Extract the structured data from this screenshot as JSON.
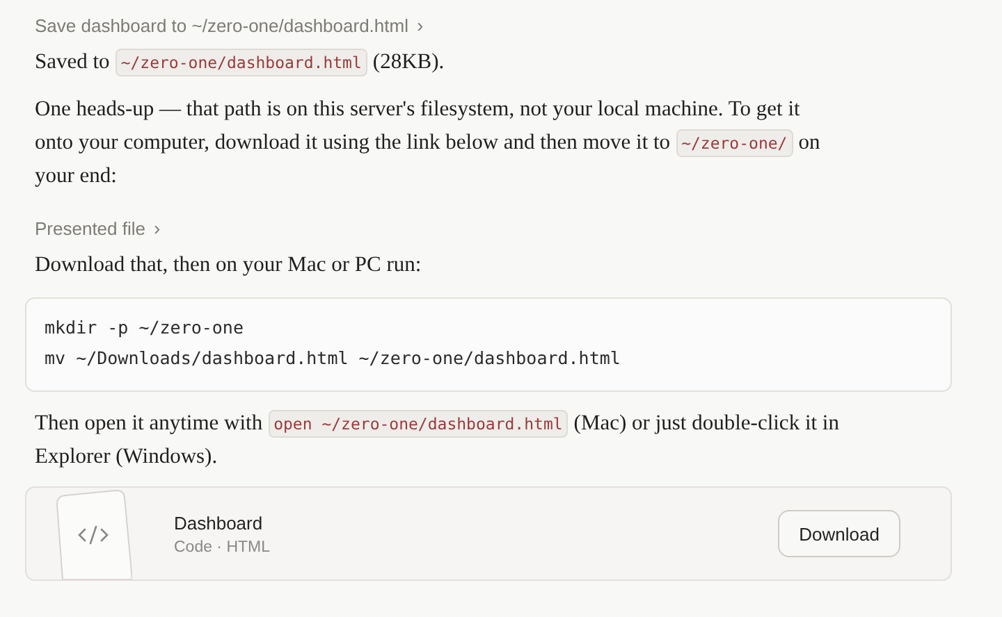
{
  "tool_step": {
    "label": "Save dashboard to ~/zero-one/dashboard.html",
    "chevron": "›"
  },
  "blocks": [
    {
      "kind": "paragraph",
      "lines": [
        [
          {
            "kind": "text",
            "text": "Saved to"
          },
          {
            "kind": "code",
            "text": "~/zero-one/dashboard.html"
          },
          {
            "kind": "text",
            "text": "(28KB)."
          }
        ]
      ]
    },
    {
      "kind": "paragraph",
      "lines": [
        [
          {
            "kind": "text",
            "text": "One heads-up — that path is on this server's filesystem, not your local machine. To get it"
          }
        ],
        [
          {
            "kind": "text",
            "text": "onto your computer, download it using the link below and then move it to"
          },
          {
            "kind": "code",
            "text": "~/zero-one/"
          },
          {
            "kind": "text",
            "text": "on"
          }
        ],
        [
          {
            "kind": "text",
            "text": "your end:"
          }
        ]
      ]
    },
    {
      "kind": "step",
      "label": "Presented file",
      "chevron": "›"
    },
    {
      "kind": "paragraph",
      "lines": [
        [
          {
            "kind": "text",
            "text": "Download that, then on your Mac or PC run:"
          }
        ]
      ]
    },
    {
      "kind": "codeblock",
      "lines": [
        "mkdir -p ~/zero-one",
        "mv ~/Downloads/dashboard.html ~/zero-one/dashboard.html"
      ]
    },
    {
      "kind": "paragraph",
      "lines": [
        [
          {
            "kind": "text",
            "text": "Then open it anytime with"
          },
          {
            "kind": "code",
            "text": "open ~/zero-one/dashboard.html"
          },
          {
            "kind": "text",
            "text": "(Mac) or just double-click it in"
          }
        ],
        [
          {
            "kind": "text",
            "text": "Explorer (Windows)."
          }
        ]
      ]
    },
    {
      "kind": "file",
      "name": "Dashboard",
      "meta": "Code · HTML",
      "button": "Download"
    }
  ]
}
